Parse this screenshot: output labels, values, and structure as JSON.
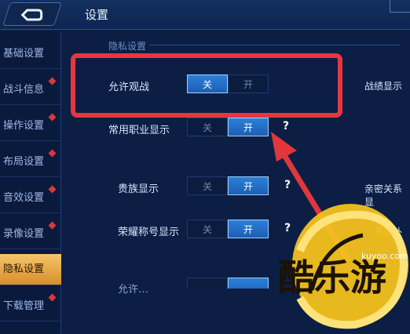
{
  "header": {
    "title": "设置"
  },
  "sidebar": {
    "items": [
      {
        "label": "基础设置",
        "active": false,
        "badge": false
      },
      {
        "label": "战斗信息",
        "active": false,
        "badge": true
      },
      {
        "label": "操作设置",
        "active": false,
        "badge": true
      },
      {
        "label": "布局设置",
        "active": false,
        "badge": true
      },
      {
        "label": "音效设置",
        "active": false,
        "badge": true
      },
      {
        "label": "录像设置",
        "active": false,
        "badge": true
      },
      {
        "label": "隐私设置",
        "active": true,
        "badge": false
      },
      {
        "label": "下载管理",
        "active": false,
        "badge": true
      }
    ]
  },
  "section": {
    "title": "隐私设置"
  },
  "rows": [
    {
      "label": "允许观战",
      "off_label": "关",
      "on_label": "开",
      "value": "关",
      "help": false
    },
    {
      "label": "常用职业显示",
      "off_label": "关",
      "on_label": "开",
      "value": "开",
      "help": true
    },
    {
      "label": "贵族显示",
      "off_label": "关",
      "on_label": "开",
      "value": "开",
      "help": true
    },
    {
      "label": "荣耀称号显示",
      "off_label": "关",
      "on_label": "开",
      "value": "开",
      "help": true
    }
  ],
  "partial_row": {
    "label": "允许…",
    "note": "bottom row partially cut off"
  },
  "right_column": {
    "items": [
      {
        "label": "战绩显示"
      },
      {
        "label": "亲密关系显"
      },
      {
        "label": "开黑外"
      }
    ]
  },
  "help_symbol": "?",
  "watermark": {
    "text": "酷乐游",
    "url": "kuyoo.com"
  },
  "colors": {
    "accent_on": "#2d7fd8",
    "active_tab": "#f4c66a",
    "highlight": "#e5373d",
    "badge": "#d9383b"
  }
}
